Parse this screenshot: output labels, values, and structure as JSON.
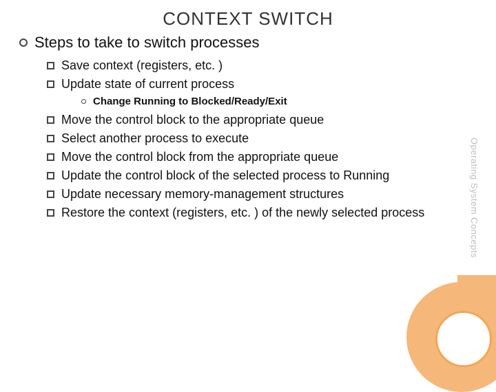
{
  "title": "CONTEXT SWITCH",
  "sideLabel": "Operating System Concepts",
  "lvl1": {
    "text": "Steps to take to switch processes"
  },
  "lvl2": [
    {
      "text": "Save context (registers, etc. )"
    },
    {
      "text": "Update state of current process"
    },
    {
      "text": "Move the control block to the appropriate queue"
    },
    {
      "text": "Select another process to execute"
    },
    {
      "text": "Move the control block from the appropriate queue"
    },
    {
      "text": "Update the control block of the selected process to Running"
    },
    {
      "text": "Update necessary memory-management structures"
    },
    {
      "text": "Restore the context (registers, etc. ) of the newly selected process"
    }
  ],
  "lvl3": {
    "text": "Change Running to Blocked/Ready/Exit"
  }
}
